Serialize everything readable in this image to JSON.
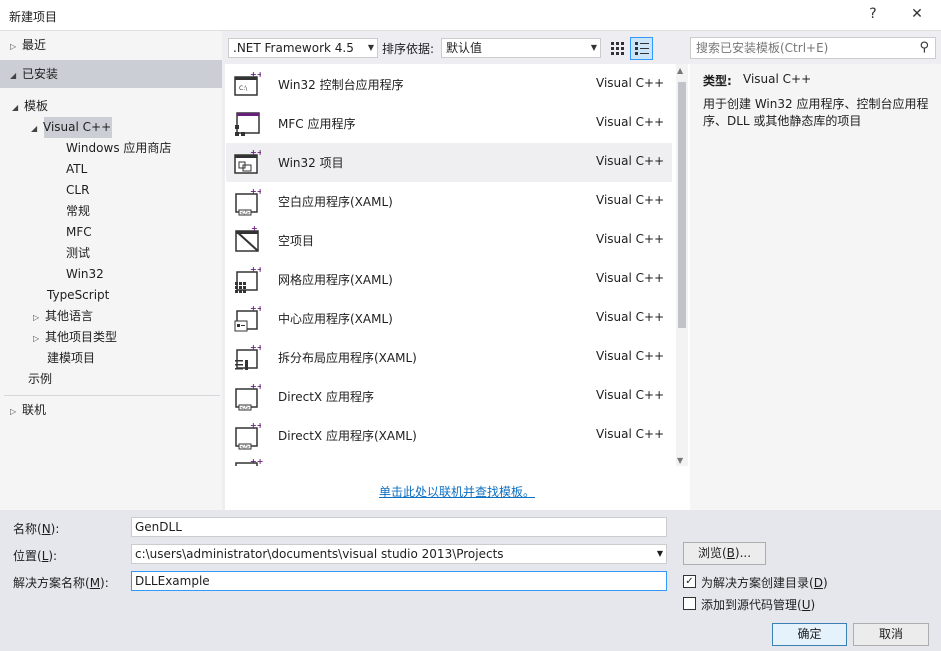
{
  "window": {
    "title": "新建项目",
    "help_label": "?",
    "close_label": "✕"
  },
  "tree": {
    "recent": "最近",
    "installed": "已安装",
    "templates": "模板",
    "visual_cpp": "Visual C++",
    "children": [
      "Windows 应用商店",
      "ATL",
      "CLR",
      "常规",
      "MFC",
      "测试",
      "Win32"
    ],
    "typescript": "TypeScript",
    "other_languages": "其他语言",
    "other_project_types": "其他项目类型",
    "modeling_projects": "建模项目",
    "samples": "示例",
    "online": "联机"
  },
  "toolbar": {
    "framework": ".NET Framework 4.5",
    "sort_label": "排序依据:",
    "sort_value": "默认值",
    "search_placeholder": "搜索已安装模板(Ctrl+E)"
  },
  "templates": [
    {
      "name": "Win32 控制台应用程序",
      "lang": "Visual C++"
    },
    {
      "name": "MFC 应用程序",
      "lang": "Visual C++"
    },
    {
      "name": "Win32 项目",
      "lang": "Visual C++"
    },
    {
      "name": "空白应用程序(XAML)",
      "lang": "Visual C++"
    },
    {
      "name": "空项目",
      "lang": "Visual C++"
    },
    {
      "name": "网格应用程序(XAML)",
      "lang": "Visual C++"
    },
    {
      "name": "中心应用程序(XAML)",
      "lang": "Visual C++"
    },
    {
      "name": "拆分布局应用程序(XAML)",
      "lang": "Visual C++"
    },
    {
      "name": "DirectX 应用程序",
      "lang": "Visual C++"
    },
    {
      "name": "DirectX 应用程序(XAML)",
      "lang": "Visual C++"
    }
  ],
  "online_link": "单击此处以联机并查找模板。",
  "details": {
    "type_label": "类型:",
    "type_value": "Visual C++",
    "description": "用于创建 Win32 应用程序、控制台应用程序、DLL 或其他静态库的项目"
  },
  "form": {
    "name_label": "名称(N):",
    "name_value": "GenDLL",
    "location_label": "位置(L):",
    "location_value": "c:\\users\\administrator\\documents\\visual studio 2013\\Projects",
    "solution_label": "解决方案名称(M):",
    "solution_value": "DLLExample",
    "browse_button": "浏览(B)...",
    "create_dir_label": "为解决方案创建目录(D)",
    "create_dir_checked": true,
    "source_control_label": "添加到源代码管理(U)",
    "source_control_checked": false,
    "ok_button": "确定",
    "cancel_button": "取消"
  }
}
